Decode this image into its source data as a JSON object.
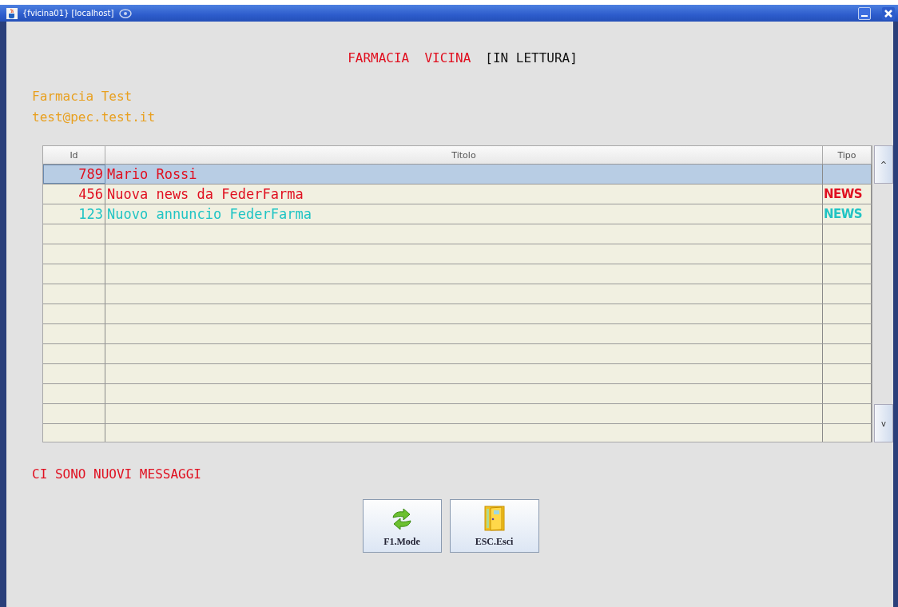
{
  "window": {
    "title": "{fvicina01} [localhost]"
  },
  "header": {
    "app_name": "FARMACIA  VICINA",
    "mode": "[IN LETTURA]"
  },
  "pharmacy": {
    "name": "Farmacia Test",
    "email": "test@pec.test.it"
  },
  "table": {
    "columns": [
      "Id",
      "Titolo",
      "Tipo"
    ],
    "rows": [
      {
        "id": "789",
        "title": "Mario Rossi",
        "type": "",
        "color": "#e01020",
        "selected": true
      },
      {
        "id": "456",
        "title": "Nuova news da FederFarma",
        "type": "NEWS",
        "color": "#e01020",
        "selected": false
      },
      {
        "id": "123",
        "title": "Nuovo annuncio FederFarma",
        "type": "NEWS",
        "color": "#20c4c4",
        "selected": false
      }
    ],
    "scroll_up": "^",
    "scroll_down": "v"
  },
  "status_message": "CI SONO NUOVI MESSAGGI",
  "buttons": [
    {
      "kind": "mode",
      "label": "F1.Mode"
    },
    {
      "kind": "exit",
      "label": "ESC.Esci"
    }
  ]
}
